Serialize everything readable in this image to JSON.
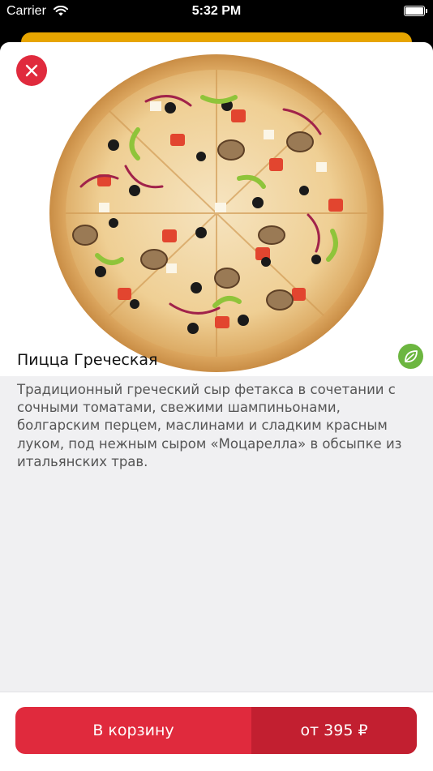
{
  "status_bar": {
    "carrier": "Carrier",
    "time": "5:32 PM",
    "battery_level": 1.0
  },
  "product": {
    "name": "Пицца Греческая",
    "description": "Традиционный греческий сыр фетакса в сочетании с сочными томатами, свежими шампиньонами, болгарским перцем, маслинами и сладким красным луком, под нежным сыром «Моцарелла» в обсыпке из итальянских трав.",
    "badge_icon": "leaf-icon"
  },
  "actions": {
    "close_icon": "close-icon",
    "cart_label": "В корзину",
    "price_label": "от 395 ₽"
  },
  "colors": {
    "accent": "#e02a3d",
    "accent_dark": "#c21f30",
    "peek_card": "#e7a500",
    "veg_badge": "#6cb640"
  }
}
